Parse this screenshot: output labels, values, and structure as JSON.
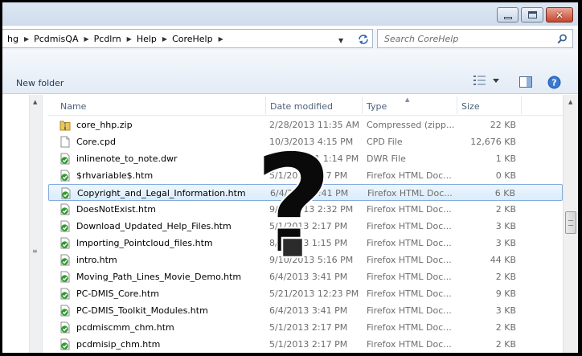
{
  "window": {
    "minimize_icon": "minimize-icon",
    "maximize_icon": "maximize-icon",
    "close_icon": "close-icon",
    "close_glyph": "✕"
  },
  "address": {
    "breadcrumbs": [
      "hg",
      "PcdmisQA",
      "Pcdlrn",
      "Help",
      "CoreHelp"
    ],
    "separator": "▶",
    "dropdown_glyph": "▼"
  },
  "search": {
    "placeholder": "Search CoreHelp"
  },
  "toolbar": {
    "new_folder_label": "New folder"
  },
  "columns": {
    "name": "Name",
    "date": "Date modified",
    "type": "Type",
    "size": "Size"
  },
  "files": [
    {
      "name": "core_hhp.zip",
      "date": "2/28/2013 11:35 AM",
      "type": "Compressed (zipp...",
      "size": "22 KB",
      "icon": "zip-folder-icon"
    },
    {
      "name": "Core.cpd",
      "date": "10/3/2013 4:15 PM",
      "type": "CPD File",
      "size": "12,676 KB",
      "icon": "blank-file-icon"
    },
    {
      "name": "inlinenote_to_note.dwr",
      "date": "10/26/2011 1:14 PM",
      "type": "DWR File",
      "size": "1 KB",
      "icon": "html-file-icon"
    },
    {
      "name": "$rhvariable$.htm",
      "date": "5/1/2013 2:17 PM",
      "type": "Firefox HTML Doc...",
      "size": "0 KB",
      "icon": "html-file-icon"
    },
    {
      "name": "Copyright_and_Legal_Information.htm",
      "date": "6/4/2013 3:41 PM",
      "type": "Firefox HTML Doc...",
      "size": "6 KB",
      "icon": "html-file-icon",
      "selected": true
    },
    {
      "name": "DoesNotExist.htm",
      "date": "9/11/2013 2:32 PM",
      "type": "Firefox HTML Doc...",
      "size": "2 KB",
      "icon": "html-file-icon"
    },
    {
      "name": "Download_Updated_Help_Files.htm",
      "date": "5/1/2013 2:17 PM",
      "type": "Firefox HTML Doc...",
      "size": "3 KB",
      "icon": "html-file-icon"
    },
    {
      "name": "Importing_Pointcloud_files.htm",
      "date": "8/8/2013 1:15 PM",
      "type": "Firefox HTML Doc...",
      "size": "3 KB",
      "icon": "html-file-icon"
    },
    {
      "name": "intro.htm",
      "date": "9/10/2013 5:16 PM",
      "type": "Firefox HTML Doc...",
      "size": "44 KB",
      "icon": "html-file-icon"
    },
    {
      "name": "Moving_Path_Lines_Movie_Demo.htm",
      "date": "6/4/2013 3:41 PM",
      "type": "Firefox HTML Doc...",
      "size": "2 KB",
      "icon": "html-file-icon"
    },
    {
      "name": "PC-DMIS_Core.htm",
      "date": "5/21/2013 12:23 PM",
      "type": "Firefox HTML Doc...",
      "size": "9 KB",
      "icon": "html-file-icon"
    },
    {
      "name": "PC-DMIS_Toolkit_Modules.htm",
      "date": "6/4/2013 3:41 PM",
      "type": "Firefox HTML Doc...",
      "size": "3 KB",
      "icon": "html-file-icon"
    },
    {
      "name": "pcdmiscmm_chm.htm",
      "date": "5/1/2013 2:17 PM",
      "type": "Firefox HTML Doc...",
      "size": "2 KB",
      "icon": "html-file-icon"
    },
    {
      "name": "pcdmisip_chm.htm",
      "date": "5/1/2013 2:17 PM",
      "type": "Firefox HTML Doc...",
      "size": "2 KB",
      "icon": "html-file-icon"
    }
  ],
  "overlay": {
    "icon": "question-mark-icon"
  },
  "colors": {
    "selection_border": "#84acdd",
    "selection_fill": "#d9ecfc",
    "firefox_green": "#2f9b2f"
  }
}
